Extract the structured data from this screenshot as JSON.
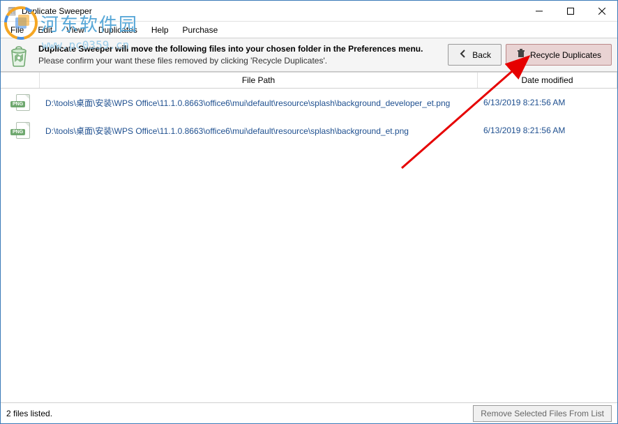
{
  "window": {
    "title": "Duplicate Sweeper"
  },
  "menu": {
    "items": [
      "File",
      "Edit",
      "View",
      "Duplicates",
      "Help",
      "Purchase"
    ]
  },
  "banner": {
    "bold_line": "Duplicate Sweeper will move the following files into your chosen folder in the Preferences menu.",
    "sub_line": "Please confirm your want these files removed by clicking 'Recycle Duplicates'.",
    "back_label": "Back",
    "recycle_label": "Recycle Duplicates"
  },
  "table": {
    "headers": {
      "path": "File Path",
      "date": "Date modified"
    },
    "rows": [
      {
        "path": "D:\\tools\\桌面\\安装\\WPS Office\\11.1.0.8663\\office6\\mui\\default\\resource\\splash\\background_developer_et.png",
        "date": "6/13/2019 8:21:56 AM",
        "type": "PNG"
      },
      {
        "path": "D:\\tools\\桌面\\安装\\WPS Office\\11.1.0.8663\\office6\\mui\\default\\resource\\splash\\background_et.png",
        "date": "6/13/2019 8:21:56 AM",
        "type": "PNG"
      }
    ]
  },
  "status": {
    "text": "2 files listed.",
    "remove_label": "Remove Selected Files From List"
  },
  "watermark": {
    "text": "河东软件园",
    "url": "www.pc0359.cn"
  }
}
